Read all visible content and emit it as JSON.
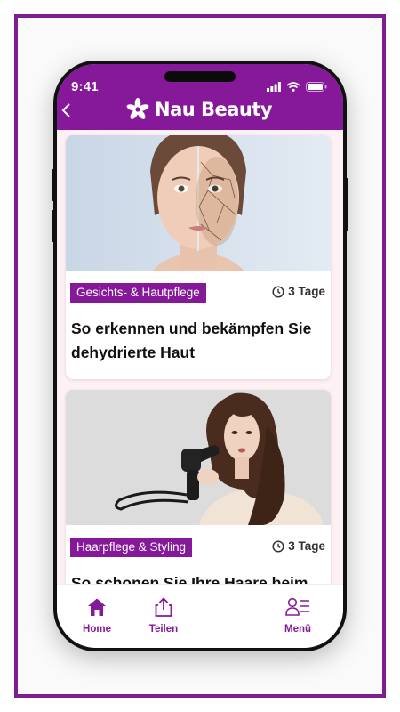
{
  "status": {
    "time": "9:41"
  },
  "header": {
    "brand": "Nau Beauty"
  },
  "articles": [
    {
      "category": "Gesichts- & Hautpflege",
      "age": "3 Tage",
      "title": "So erkennen und bekämpfen Sie dehydrierte Haut"
    },
    {
      "category": "Haarpflege & Styling",
      "age": "3 Tage",
      "title": "So schonen Sie Ihre Haare beim"
    }
  ],
  "tabbar": {
    "home": "Home",
    "share": "Teilen",
    "menu": "Menü"
  },
  "colors": {
    "accent": "#86189a",
    "background": "#fdf1f4"
  },
  "icons": [
    "back-icon",
    "flower-logo-icon",
    "signal-icon",
    "wifi-icon",
    "battery-icon",
    "clock-icon",
    "home-icon",
    "share-icon",
    "menu-icon"
  ]
}
